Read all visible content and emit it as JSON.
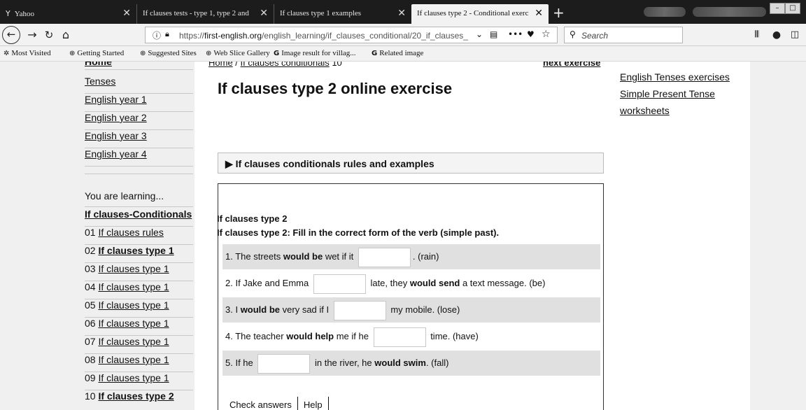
{
  "browser": {
    "tabs": [
      {
        "title": "Yahoo",
        "icon": "Y",
        "active": false
      },
      {
        "title": "If clauses tests - type 1, type 2 and",
        "active": false
      },
      {
        "title": "If clauses type 1 examples",
        "active": false
      },
      {
        "title": "If clauses type 2 - Conditional exerc",
        "active": true
      }
    ],
    "new_tab": "+",
    "url_prefix": "https://",
    "url_host": "first-english.org",
    "url_path": "/english_learning/if_clauses_conditional/20_if_clauses_",
    "search_placeholder": "Search",
    "bookmarks": [
      "Most Visited",
      "Getting Started",
      "Suggested Sites",
      "Web Slice Gallery",
      "Image result for villag...",
      "Related image"
    ]
  },
  "sidebar": {
    "items_top": [
      "Home",
      "Tenses",
      "English year 1",
      "English year 2",
      "English year 3",
      "English year 4"
    ],
    "learning_label": "You are learning...",
    "section_title": "If clauses-Conditionals",
    "lessons": [
      {
        "num": "01",
        "label": "If clauses rules",
        "bold": false
      },
      {
        "num": "02",
        "label": "If clauses type 1",
        "bold": true
      },
      {
        "num": "03",
        "label": "If clauses type 1",
        "bold": false
      },
      {
        "num": "04",
        "label": "If clauses type 1",
        "bold": false
      },
      {
        "num": "05",
        "label": "If clauses type 1",
        "bold": false
      },
      {
        "num": "06",
        "label": "If clauses type 1",
        "bold": false
      },
      {
        "num": "07",
        "label": "If clauses type 1",
        "bold": false
      },
      {
        "num": "08",
        "label": "If clauses type 1",
        "bold": false
      },
      {
        "num": "09",
        "label": "If clauses type 1",
        "bold": false
      },
      {
        "num": "10",
        "label": "If clauses type 2",
        "bold": true
      }
    ]
  },
  "main": {
    "breadcrumb": {
      "home": "Home",
      "sep": " / ",
      "section": "If clauses conditionals",
      "num": " 10"
    },
    "next": "next exercise",
    "title": "If clauses type 2 online exercise",
    "rules_toggle": "▶ If clauses conditionals rules and examples",
    "exercise_title": "If clauses type 2",
    "exercise_instruction": "If clauses type 2: Fill in the correct form of the verb (simple past).",
    "questions": [
      {
        "pre": "1. The streets ",
        "bold": "would be",
        "mid": " wet if it ",
        "blank_value": "",
        "post": ". (rain)"
      },
      {
        "pre": "2. If Jake and Emma ",
        "blank_value": "",
        "mid": " late, they ",
        "bold": "would send",
        "post": " a text message. (be)"
      },
      {
        "pre": "3. I ",
        "bold": "would be",
        "mid": " very sad if I ",
        "blank_value": "",
        "post": " my mobile. (lose)"
      },
      {
        "pre": "4. The teacher ",
        "bold": "would help",
        "mid": " me if he ",
        "blank_value": "",
        "post": " time. (have)"
      },
      {
        "pre": "5. If he ",
        "blank_value": "",
        "mid": " in the river, he ",
        "bold": "would swim",
        "post": ". (fall)"
      }
    ],
    "check_button": "Check answers",
    "help_button": "Help"
  },
  "right": {
    "links": [
      "English Tenses exercises",
      "Simple Present Tense worksheets"
    ]
  }
}
